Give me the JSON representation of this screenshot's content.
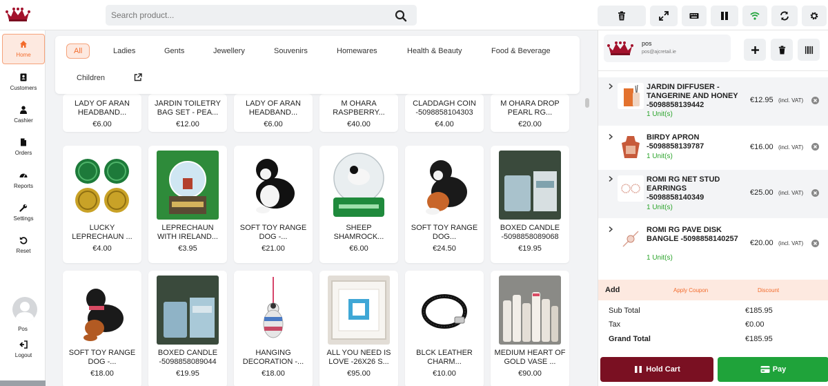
{
  "search": {
    "placeholder": "Search product..."
  },
  "nav": [
    {
      "label": "Home"
    },
    {
      "label": "Customers"
    },
    {
      "label": "Cashier"
    },
    {
      "label": "Orders"
    },
    {
      "label": "Reports"
    },
    {
      "label": "Settings"
    },
    {
      "label": "Reset"
    }
  ],
  "user": {
    "name": "Pos",
    "logout": "Logout"
  },
  "categories": [
    "All",
    "Ladies",
    "Gents",
    "Jewellery",
    "Souvenirs",
    "Homewares",
    "Health & Beauty",
    "Food & Beverage",
    "Children"
  ],
  "products": [
    {
      "name": "LADY OF ARAN HEADBAND...",
      "price": "€6.00"
    },
    {
      "name": "JARDIN TOILETRY BAG SET - PEA...",
      "price": "€12.00"
    },
    {
      "name": "LADY OF ARAN HEADBAND...",
      "price": "€6.00"
    },
    {
      "name": "M OHARA RASPBERRY...",
      "price": "€40.00"
    },
    {
      "name": "CLADDAGH COIN -5098858104303",
      "price": "€4.00"
    },
    {
      "name": "M OHARA DROP PEARL RG...",
      "price": "€20.00"
    },
    {
      "name": "LUCKY LEPRECHAUN ...",
      "price": "€4.00"
    },
    {
      "name": "LEPRECHAUN WITH IRELAND...",
      "price": "€3.95"
    },
    {
      "name": "SOFT TOY RANGE DOG -...",
      "price": "€21.00"
    },
    {
      "name": "SHEEP SHAMROCK...",
      "price": "€6.00"
    },
    {
      "name": "SOFT TOY RANGE DOG...",
      "price": "€24.50"
    },
    {
      "name": "BOXED CANDLE -5098858089068",
      "price": "€19.95"
    },
    {
      "name": "SOFT TOY RANGE DOG -...",
      "price": "€18.00"
    },
    {
      "name": "BOXED CANDLE -5098858089044",
      "price": "€19.95"
    },
    {
      "name": "HANGING DECORATION -...",
      "price": "€18.00"
    },
    {
      "name": "ALL YOU NEED IS LOVE -26X26 S...",
      "price": "€95.00"
    },
    {
      "name": "BLCK LEATHER CHARM...",
      "price": "€10.00"
    },
    {
      "name": "MEDIUM HEART OF GOLD VASE ...",
      "price": "€90.00"
    }
  ],
  "customer": {
    "name": "pos",
    "email": "pos@ajcretail.ie"
  },
  "cart_items": [
    {
      "name": "JARDIN DIFFUSER - TANGERINE AND HONEY -5098858139442",
      "qty": "1 Unit(s)",
      "price": "€12.95",
      "vat": "(incl. VAT)"
    },
    {
      "name": "BIRDY APRON -5098858139787",
      "qty": "1 Unit(s)",
      "price": "€16.00",
      "vat": "(incl. VAT)"
    },
    {
      "name": "ROMI RG NET STUD EARRINGS -5098858140349",
      "qty": "1 Unit(s)",
      "price": "€25.00",
      "vat": "(incl. VAT)"
    },
    {
      "name": "ROMI RG PAVE DISK BANGLE -5098858140257",
      "qty": "1 Unit(s)",
      "price": "€20.00",
      "vat": "(incl. VAT)"
    }
  ],
  "cart_actions": {
    "add": "Add",
    "coupon": "Apply Coupon",
    "discount": "Discount"
  },
  "totals": {
    "subtotal_label": "Sub Total",
    "subtotal": "€185.95",
    "tax_label": "Tax",
    "tax": "€0.00",
    "grand_label": "Grand Total",
    "grand": "€185.95"
  },
  "buttons": {
    "hold": "Hold Cart",
    "pay": "Pay"
  },
  "colors": {
    "accent": "#f26b2c",
    "hold": "#7a1022",
    "pay": "#1fa33a",
    "qty": "#29a329"
  }
}
